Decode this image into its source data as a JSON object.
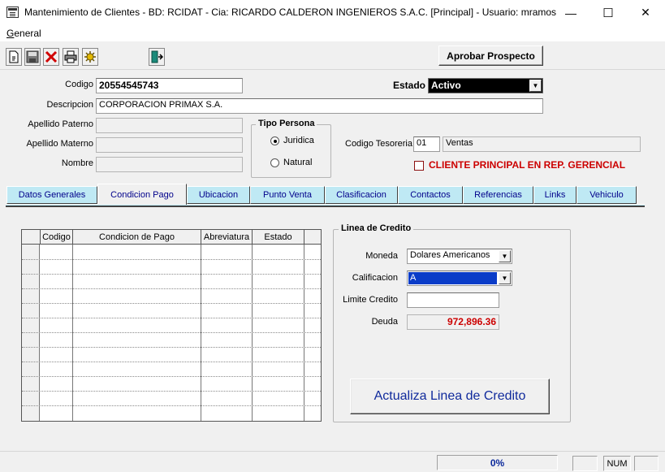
{
  "window": {
    "title": "Mantenimiento de Clientes - BD: RCIDAT - Cia: RICARDO CALDERON INGENIEROS S.A.C. [Principal] - Usuario: mramos",
    "minimize": "—",
    "maximize": "☐",
    "close": "✕"
  },
  "menu": {
    "general": "General"
  },
  "toolbar": {
    "icons": [
      "new-document-icon",
      "save-disk-icon",
      "delete-x-icon",
      "print-icon",
      "tools-icon",
      "exit-door-icon"
    ],
    "aprobar_label": "Aprobar Prospecto"
  },
  "form": {
    "codigo_label": "Codigo",
    "codigo_value": "20554545743",
    "estado_label": "Estado",
    "estado_value": "Activo",
    "descripcion_label": "Descripcion",
    "descripcion_value": "CORPORACION PRIMAX S.A.",
    "apellido_paterno_label": "Apellido Paterno",
    "apellido_materno_label": "Apellido Materno",
    "nombre_label": "Nombre",
    "tipo_persona": {
      "legend": "Tipo Persona",
      "juridica": "Juridica",
      "natural": "Natural",
      "selected": "Juridica"
    },
    "codigo_tesoreria_label": "Codigo Tesoreria",
    "codigo_tesoreria_code": "01",
    "codigo_tesoreria_desc": "Ventas",
    "cliente_principal_label": "CLIENTE PRINCIPAL EN REP. GERENCIAL",
    "cliente_principal_checked": false,
    "accent_red": "#cc0000"
  },
  "tabs": [
    "Datos Generales",
    "Condicion Pago",
    "Ubicacion",
    "Punto Venta",
    "Clasificacion",
    "Contactos",
    "Referencias",
    "Links",
    "Vehiculo"
  ],
  "active_tab": "Condicion Pago",
  "grid": {
    "columns": [
      "Codigo",
      "Condicion de Pago",
      "Abreviatura",
      "Estado"
    ],
    "rows": []
  },
  "linea_credito": {
    "legend": "Linea de Credito",
    "moneda_label": "Moneda",
    "moneda_value": "Dolares Americanos",
    "calificacion_label": "Calificacion",
    "calificacion_value": "A",
    "limite_label": "Limite Credito",
    "limite_value": "",
    "deuda_label": "Deuda",
    "deuda_value": "972,896.36",
    "actualiza_label": "Actualiza Linea de Credito"
  },
  "statusbar": {
    "progress_text": "0%",
    "num_label": "NUM"
  }
}
